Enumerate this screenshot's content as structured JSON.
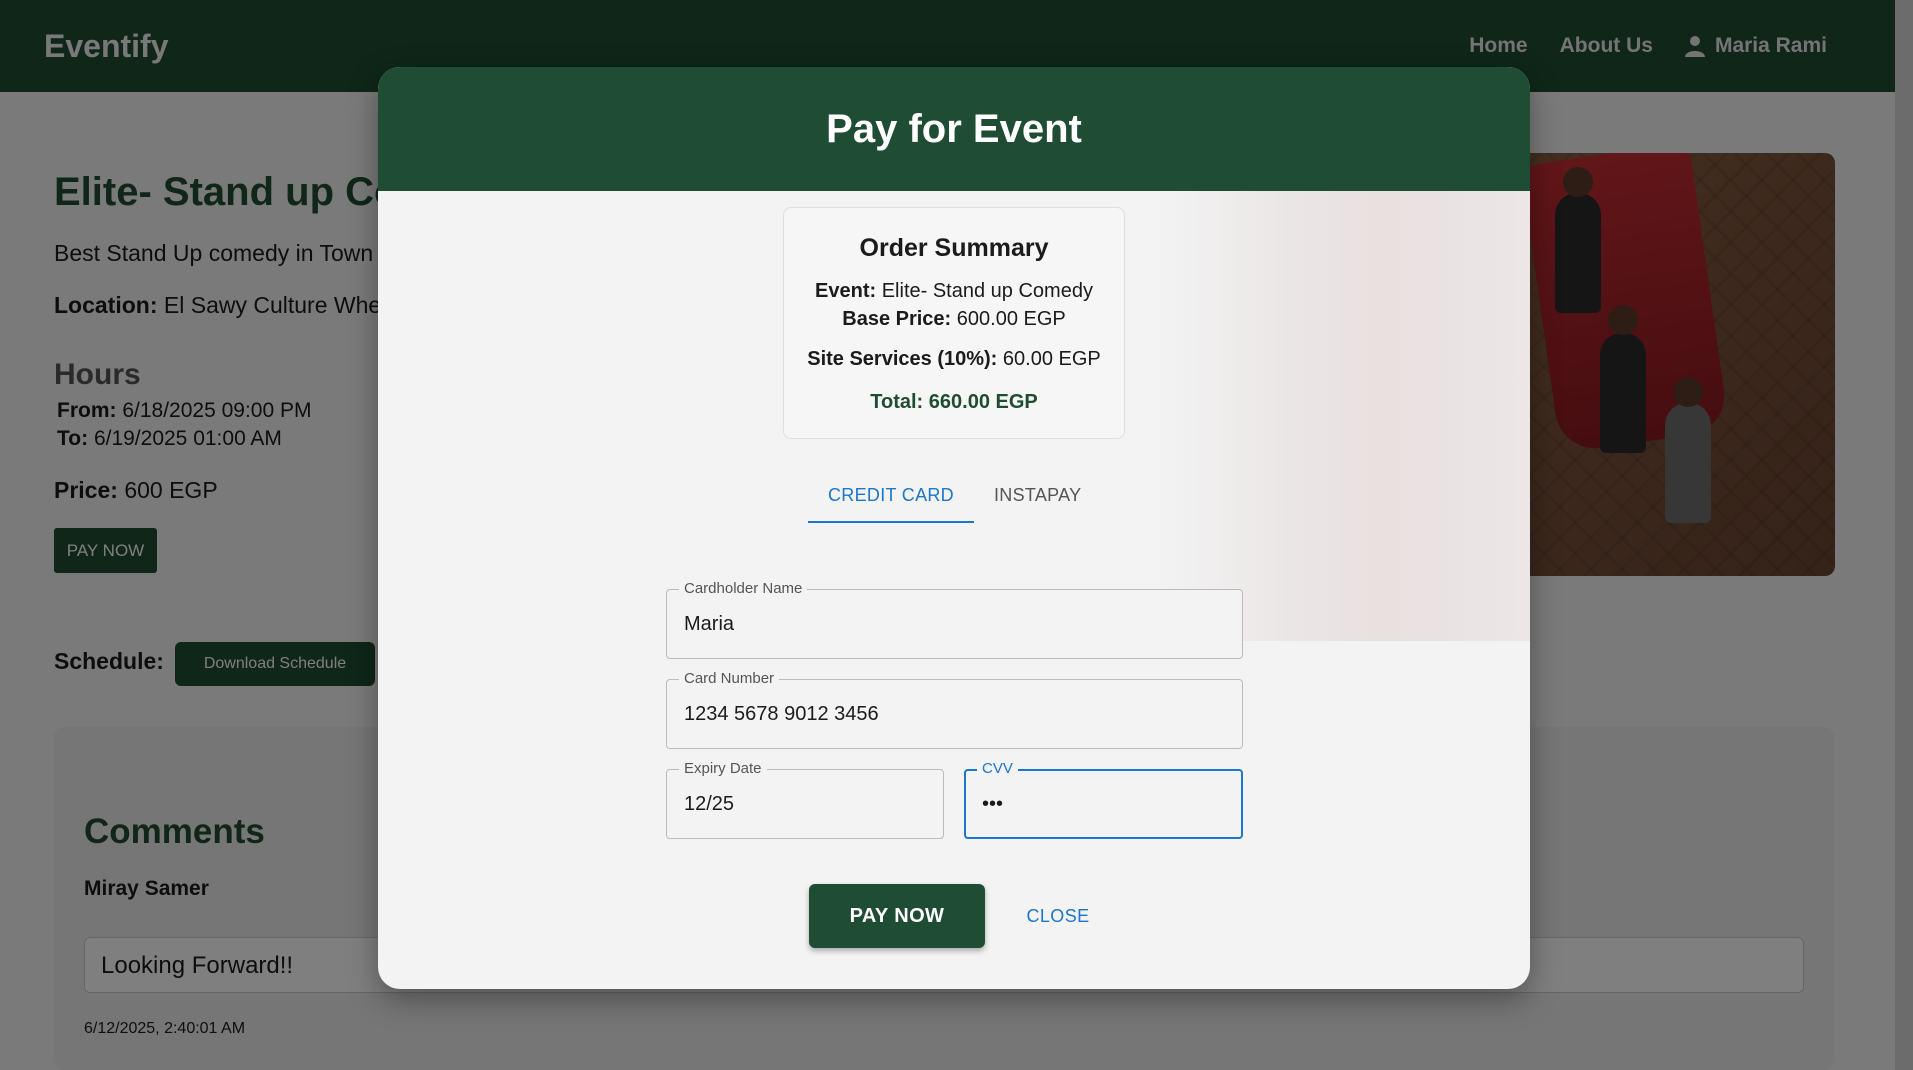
{
  "nav": {
    "brand": "Eventify",
    "links": [
      "Home",
      "About Us"
    ],
    "user_name": "Maria Rami"
  },
  "event": {
    "title": "Elite- Stand up Comedy",
    "description": "Best Stand Up comedy in Town",
    "location_label": "Location:",
    "location": "El Sawy Culture Wheel",
    "hours_title": "Hours",
    "from_label": "From:",
    "from": "6/18/2025 09:00 PM",
    "to_label": "To:",
    "to": "6/19/2025 01:00 AM",
    "price_label": "Price:",
    "price": "600 EGP",
    "pay_now": "PAY NOW",
    "schedule_label": "Schedule:",
    "download_schedule": "Download Schedule"
  },
  "comments": {
    "title": "Comments",
    "items": [
      {
        "author": "Miray Samer",
        "text": "Looking Forward!!",
        "date": "6/12/2025, 2:40:01 AM"
      }
    ]
  },
  "modal": {
    "title": "Pay for Event",
    "summary": {
      "title": "Order Summary",
      "event_label": "Event:",
      "event_value": "Elite- Stand up Comedy",
      "base_label": "Base Price:",
      "base_value": "600.00 EGP",
      "fee_label": "Site Services (10%):",
      "fee_value": "60.00 EGP",
      "total_label": "Total:",
      "total_value": "660.00 EGP"
    },
    "tabs": [
      {
        "label": "CREDIT CARD",
        "active": true
      },
      {
        "label": "INSTAPAY",
        "active": false
      }
    ],
    "fields": {
      "cardholder_label": "Cardholder Name",
      "cardholder_value": "Maria",
      "card_number_label": "Card Number",
      "card_number_value": "1234 5678 9012 3456",
      "expiry_label": "Expiry Date",
      "expiry_value": "12/25",
      "cvv_label": "CVV",
      "cvv_value": "•••"
    },
    "pay_button": "PAY NOW",
    "close_button": "CLOSE"
  },
  "colors": {
    "primary_green": "#1f4d33",
    "accent_blue": "#1976d2"
  },
  "icons": {
    "user": "user-icon"
  }
}
